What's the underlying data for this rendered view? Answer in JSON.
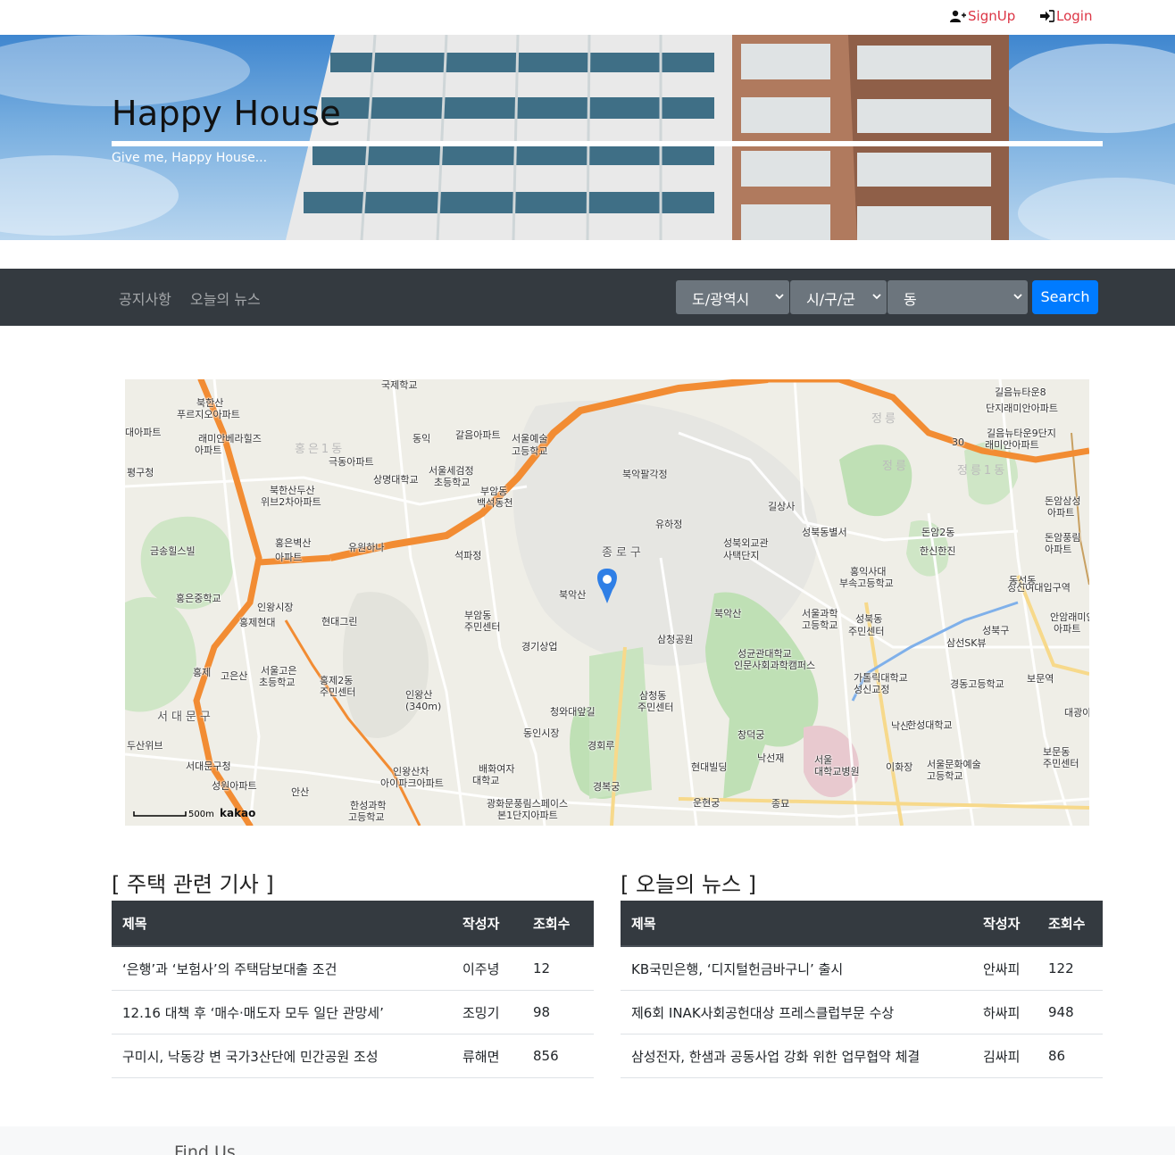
{
  "auth": {
    "signup_label": "SignUp",
    "login_label": "Login"
  },
  "hero": {
    "title": "Happy House",
    "subtitle": "Give me, Happy House..."
  },
  "nav": {
    "links": [
      "공지사항",
      "오늘의 뉴스"
    ],
    "selects": {
      "sido": "도/광역시",
      "gugun": "시/구/군",
      "dong": "동"
    },
    "search_label": "Search"
  },
  "map": {
    "scale_label": "500m",
    "brand": "kakao",
    "labels": [
      "국제학교",
      "북한산",
      "푸르지오아파트",
      "대아파트",
      "래미안베라힐즈",
      "아파트",
      "평구청",
      "홍은1동",
      "극동아파트",
      "동익",
      "갈음아파트",
      "서울예술",
      "고등학교",
      "상명대학교",
      "서울세검정",
      "초등학교",
      "북한산두산",
      "위브2차아파트",
      "부암동",
      "백석동천",
      "북악팔각정",
      "유하정",
      "길상사",
      "성북동별서",
      "금송힐스빌",
      "홍은벽산",
      "아파트",
      "유원하나",
      "석파정",
      "종로구",
      "북악산",
      "성북외교관",
      "사택단지",
      "홍익사대",
      "부속고등학교",
      "한신한진",
      "홍은중학교",
      "인왕시장",
      "홍제현대",
      "현대그린",
      "부암동",
      "주민센터",
      "북악산",
      "서울과학",
      "고등학교",
      "성북동",
      "주민센터",
      "성신여대입구역",
      "홍제",
      "고은산",
      "경기상업",
      "삼청공원",
      "성균관대학교",
      "인문사회과학캠퍼스",
      "삼선SK뷰",
      "서울고은",
      "초등학교",
      "홍제2동",
      "주민센터",
      "인왕산",
      "(340m)",
      "삼청동",
      "주민센터",
      "청와대앞길",
      "가톨릭대학교",
      "성신교정",
      "경동고등학교",
      "보문역",
      "서대문구",
      "동인시장",
      "경회루",
      "창덕궁",
      "낙산",
      "한성대학교",
      "두산위브",
      "서대문구청",
      "인왕산차",
      "아이파크아파트",
      "배화여자",
      "대학교",
      "낙선재",
      "이화장",
      "서울문화예술",
      "고등학교",
      "보문동",
      "주민센터",
      "성원아파트",
      "안산",
      "한성과학",
      "고등학교",
      "광화문풍림스페이스",
      "본1단지아파트",
      "경복궁",
      "현대빌딩",
      "운현궁",
      "종묘",
      "서울",
      "대학교병원",
      "길음뉴타운8",
      "단지래미안아파트",
      "길음뉴타운9단지",
      "래미안아파트",
      "돈암삼성",
      "아파트",
      "돈암풍림",
      "아파트",
      "안암래미안",
      "아파트",
      "대광아",
      "정릉",
      "정릉",
      "정릉1동",
      "돈암2동",
      "성북구",
      "동선동",
      "30"
    ]
  },
  "sections": {
    "left_title": "[ 주택 관련 기사 ]",
    "right_title": "[ 오늘의 뉴스 ]"
  },
  "tables": {
    "headers": [
      "제목",
      "작성자",
      "조회수"
    ],
    "housing": [
      [
        "‘은행’과 ‘보험사’의 주택담보대출 조건",
        "이주녕",
        "12"
      ],
      [
        "12.16 대책 후 ‘매수·매도자 모두 일단 관망세’",
        "조밍기",
        "98"
      ],
      [
        "구미시, 낙동강 변 국가3산단에 민간공원 조성",
        "류해면",
        "856"
      ]
    ],
    "news": [
      [
        "KB국민은행, ‘디지털헌금바구니’ 출시",
        "안싸피",
        "122"
      ],
      [
        "제6회 INAK사회공헌대상 프레스클럽부문 수상",
        "하싸피",
        "948"
      ],
      [
        "삼성전자, 한샘과 공동사업 강화 위한 업무협약 체결",
        "김싸피",
        "86"
      ]
    ]
  },
  "footer": {
    "title": "Find Us"
  },
  "colors": {
    "accent": "#007bff",
    "navbar": "#343a40",
    "auth": "#dc3545"
  }
}
